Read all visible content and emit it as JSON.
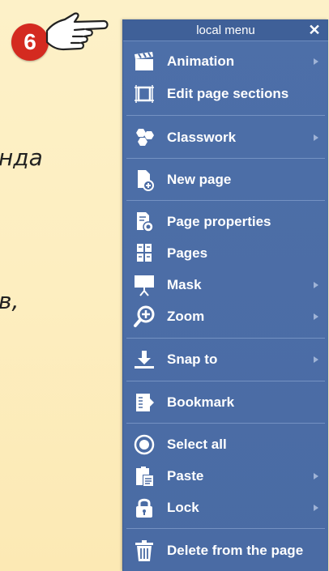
{
  "background": {
    "text_line_1": "нда",
    "text_line_2": "в,"
  },
  "callout": {
    "number": "6",
    "hand_icon": "pointing-hand-icon"
  },
  "menu": {
    "title": "local menu",
    "close_label": "✕",
    "items": [
      {
        "label": "Animation",
        "icon": "clapperboard-icon",
        "submenu": true
      },
      {
        "label": "Edit page sections",
        "icon": "crop-frame-icon",
        "submenu": false
      },
      {
        "label": "Classwork",
        "icon": "hexagons-icon",
        "submenu": true
      },
      {
        "label": "New page",
        "icon": "new-page-icon",
        "submenu": false
      },
      {
        "label": "Page properties",
        "icon": "page-settings-icon",
        "submenu": false
      },
      {
        "label": "Pages",
        "icon": "pages-grid-icon",
        "submenu": false
      },
      {
        "label": "Mask",
        "icon": "easel-icon",
        "submenu": true
      },
      {
        "label": "Zoom",
        "icon": "zoom-icon",
        "submenu": true
      },
      {
        "label": "Snap to",
        "icon": "download-arrow-icon",
        "submenu": true
      },
      {
        "label": "Bookmark",
        "icon": "bookmark-icon",
        "submenu": false
      },
      {
        "label": "Select all",
        "icon": "radio-target-icon",
        "submenu": false
      },
      {
        "label": "Paste",
        "icon": "paste-icon",
        "submenu": true
      },
      {
        "label": "Lock",
        "icon": "padlock-icon",
        "submenu": true
      },
      {
        "label": "Delete from the page",
        "icon": "trash-icon",
        "submenu": false
      }
    ]
  },
  "colors": {
    "menu_bg": "#4a6ba4",
    "badge": "#d42a20",
    "page_bg": "#fdf1c8"
  }
}
